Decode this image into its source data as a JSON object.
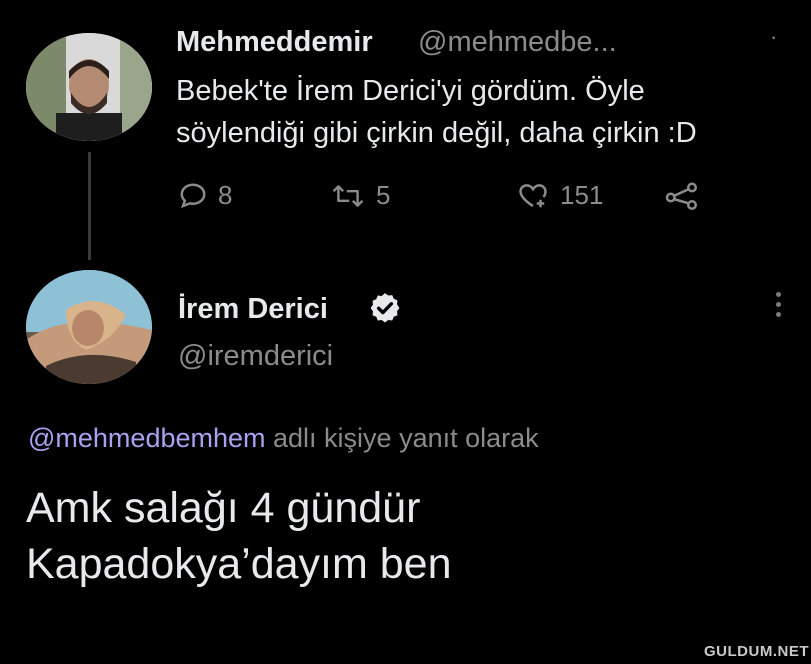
{
  "tweet1": {
    "author_name": "Mehmeddemir",
    "author_handle": "@mehmedbe...",
    "text": "Bebek'te İrem Derici'yi gördüm. Öyle\nsöylendiği gibi çirkin değil, daha çirkin :D",
    "reply_count": "8",
    "retweet_count": "5",
    "like_count": "151",
    "menu_dot": "·"
  },
  "tweet2": {
    "author_name": "İrem Derici",
    "author_handle": "@iremderici",
    "verified": true,
    "reply_to_handle": "@mehmedbemhem",
    "reply_to_suffix": " adlı kişiye yanıt olarak",
    "text": "Amk salağı 4 gündür\nKapadokya’dayım ben"
  },
  "watermark": "GULDUM.NET",
  "colors": {
    "background": "#000000",
    "text_primary": "#e7e9ea",
    "text_secondary": "#8b8b8b",
    "mention": "#a8a3f0",
    "verified": "#e7e9ea"
  },
  "icons": {
    "reply": "reply-icon",
    "retweet": "retweet-icon",
    "like": "like-add-icon",
    "share": "share-icon",
    "verified": "verified-badge-icon",
    "more": "more-options-icon"
  }
}
